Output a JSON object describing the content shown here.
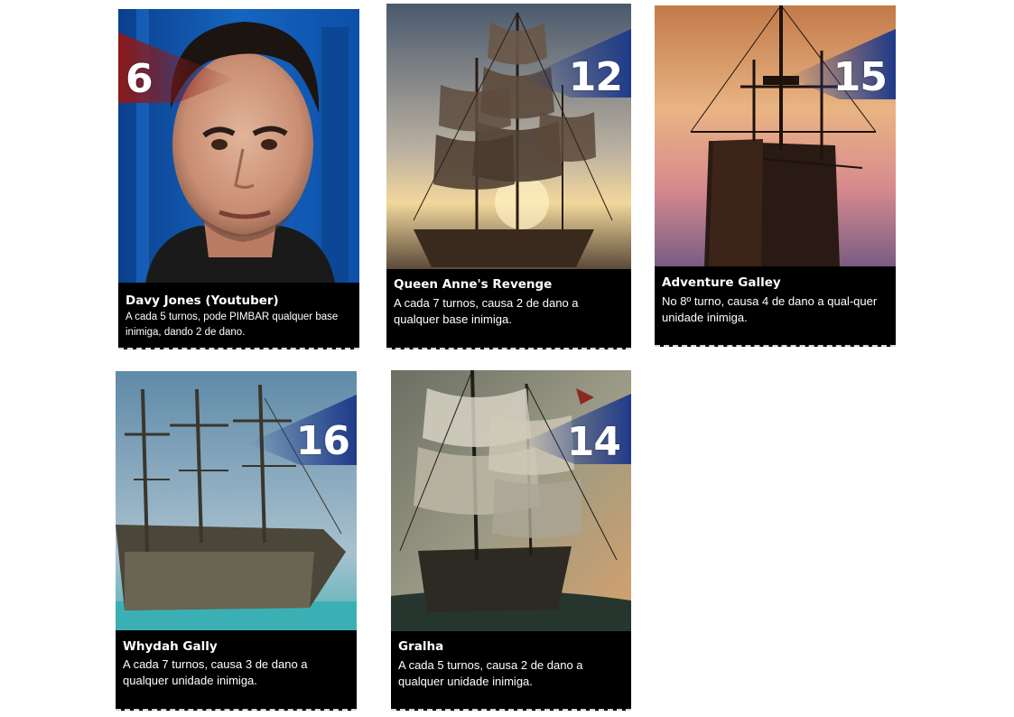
{
  "cards": [
    {
      "cost": "6",
      "name": "Davy Jones (Youtuber)",
      "description": "A cada 5 turnos, pode PIMBAR qualquer base inimiga, dando 2 de dano.",
      "badge_color": "#8b1a1a",
      "art": "portrait-photo"
    },
    {
      "cost": "12",
      "name": "Queen Anne's Revenge",
      "description": "A cada 7 turnos, causa 2 de dano a qualquer base inimiga.",
      "badge_color": "#1f3a8a",
      "art": "pirate-ship-sunset"
    },
    {
      "cost": "15",
      "name": "Adventure Galley",
      "description": "No 8º turno, causa 4 de dano a qual-quer unidade inimiga.",
      "badge_color": "#1f3a8a",
      "art": "galleon-silhouette-sunset"
    },
    {
      "cost": "16",
      "name": "Whydah Gally",
      "description": "A cada 7 turnos, causa 3 de dano a qualquer unidade inimiga.",
      "badge_color": "#1f3a8a",
      "art": "ghost-ship-shallow-water"
    },
    {
      "cost": "14",
      "name": "Gralha",
      "description": "A cada 5 turnos, causa 2 de dano a qualquer unidade inimiga.",
      "badge_color": "#1f3a8a",
      "art": "pirate-ship-storm"
    }
  ]
}
